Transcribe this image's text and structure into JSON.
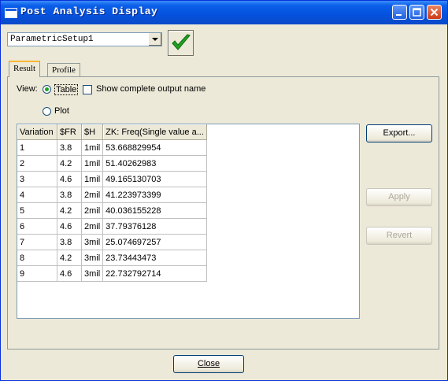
{
  "window": {
    "title": "Post Analysis Display"
  },
  "setup": {
    "selected": "ParametricSetup1"
  },
  "tabs": [
    {
      "label": "Result"
    },
    {
      "label": "Profile"
    }
  ],
  "view": {
    "label": "View:",
    "table_label": "Table",
    "plot_label": "Plot",
    "selected": "Table",
    "show_complete_label": "Show complete output name",
    "show_complete_checked": false
  },
  "table": {
    "headers": [
      "Variation",
      "$FR",
      "$H",
      "ZK: Freq(Single value a..."
    ],
    "rows": [
      [
        "1",
        "3.8",
        "1mil",
        "53.668829954"
      ],
      [
        "2",
        "4.2",
        "1mil",
        "51.40262983"
      ],
      [
        "3",
        "4.6",
        "1mil",
        "49.165130703"
      ],
      [
        "4",
        "3.8",
        "2mil",
        "41.223973399"
      ],
      [
        "5",
        "4.2",
        "2mil",
        "40.036155228"
      ],
      [
        "6",
        "4.6",
        "2mil",
        "37.79376128"
      ],
      [
        "7",
        "3.8",
        "3mil",
        "25.074697257"
      ],
      [
        "8",
        "4.2",
        "3mil",
        "23.73443473"
      ],
      [
        "9",
        "4.6",
        "3mil",
        "22.732792714"
      ]
    ]
  },
  "buttons": {
    "export": "Export...",
    "apply": "Apply",
    "revert": "Revert",
    "close": "Close"
  },
  "colors": {
    "titlebar": "#0553e0",
    "dialog_bg": "#ece9d8",
    "check": "#21a121"
  }
}
